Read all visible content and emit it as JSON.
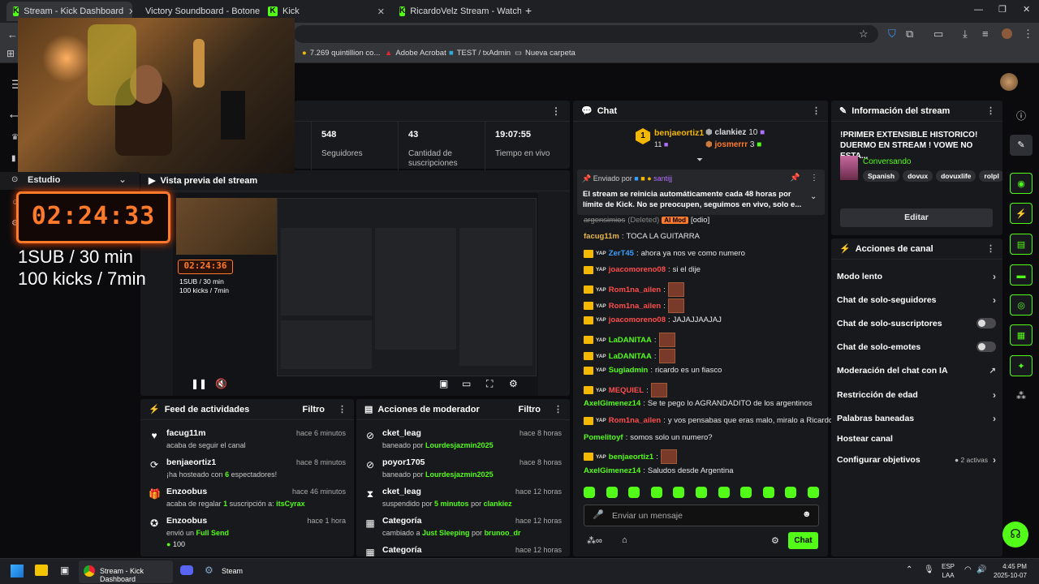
{
  "browser": {
    "tabs": [
      {
        "title": "Stream - Kick Dashboard",
        "icon": "kick"
      },
      {
        "title": "Victory Soundboard - Botones",
        "icon": "victory"
      },
      {
        "title": "Kick",
        "icon": "kick"
      },
      {
        "title": "RicardoVelz Stream - Watch",
        "icon": "kick"
      }
    ],
    "bookmarks": [
      "7.269 quintillion co...",
      "Adobe Acrobat",
      "TEST / txAdmin",
      "Nueva carpeta"
    ]
  },
  "stats": [
    {
      "value": "548",
      "label": "Seguidores"
    },
    {
      "value": "43",
      "label": "Cantidad de suscripciones"
    },
    {
      "value": "19:07:55",
      "label": "Tiempo en vivo"
    }
  ],
  "overlay": {
    "scene": "Estudio",
    "timer": "02:24:33",
    "line1": "1SUB / 30 min",
    "line2": "100 kicks / 7min"
  },
  "preview": {
    "title": "Vista previa del stream",
    "mini_timer": "02:24:36",
    "mini_line1": "1SUB / 30 min",
    "mini_line2": "100 kicks / 7min"
  },
  "feed": {
    "title": "Feed de actividades",
    "filter": "Filtro",
    "items": [
      {
        "name": "facug11m",
        "desc": "acaba de seguir el canal",
        "time": "hace 6 minutos",
        "icon": "heart-icon"
      },
      {
        "name": "benjaeortiz1",
        "desc_pre": "¡ha hosteado con ",
        "desc_hl": "6",
        "desc_post": " espectadores!",
        "time": "hace 8 minutos",
        "icon": "host-icon"
      },
      {
        "name": "Enzoobus",
        "desc_pre": "acaba de regalar ",
        "desc_hl": "1",
        "desc_post": " suscripción a: ",
        "desc_hl2": "itsCyrax",
        "time": "hace 46 minutos",
        "icon": "gift-icon"
      },
      {
        "name": "Enzoobus",
        "desc_pre": "envió un ",
        "desc_hl": "Full Send",
        "kicks": "100",
        "time": "hace 1 hora",
        "icon": "kicks-icon"
      }
    ]
  },
  "mod": {
    "title": "Acciones de moderador",
    "filter": "Filtro",
    "items": [
      {
        "name": "cket_leag",
        "desc_pre": "baneado por ",
        "desc_hl": "Lourdesjazmin2025",
        "time": "hace 8 horas",
        "icon": "ban-icon"
      },
      {
        "name": "poyor1705",
        "desc_pre": "baneado por ",
        "desc_hl": "Lourdesjazmin2025",
        "time": "hace 8 horas",
        "icon": "ban-icon"
      },
      {
        "name": "cket_leag",
        "desc_pre": "suspendido por ",
        "desc_hl": "5 minutos",
        "desc_post": " por ",
        "desc_hl2": "clankiez",
        "time": "hace 12 horas",
        "icon": "timeout-icon"
      },
      {
        "name": "Categoría",
        "desc_pre": "cambiado a ",
        "desc_hl": "Just Sleeping",
        "desc_post": " por ",
        "desc_hl2": "brunoo_dr",
        "time": "hace 12 horas",
        "icon": "category-icon"
      },
      {
        "name": "Categoría",
        "time": "hace 12 horas",
        "icon": "category-icon"
      }
    ]
  },
  "chat": {
    "title": "Chat",
    "top_gifter": {
      "rank": "1",
      "name": "benjaeortiz1",
      "count": "11"
    },
    "gifters": [
      {
        "name": "clankiez",
        "count": "10"
      },
      {
        "name": "josmerrr",
        "count": "3"
      }
    ],
    "pinned": {
      "by_label": "Enviado por",
      "by_name": "santijj",
      "text": "El stream se reinicia automáticamente cada 48 horas por límite de Kick. No se preocupen, seguimos en vivo, solo e..."
    },
    "deleted": {
      "name": "argensimios",
      "tag": "(Deleted)",
      "badge": "AI Mod",
      "extra": "[odio]"
    },
    "messages": [
      {
        "user": "facug11m",
        "color": "#e8b84a",
        "text": "TOCA LA GUITARRA"
      },
      {
        "user": "ZerT45",
        "color": "#3aa0ff",
        "text": "ahora ya nos ve como numero"
      },
      {
        "user": "joacomoreno08",
        "color": "#ff4d4d",
        "text": "si el dije"
      },
      {
        "user": "Rom1na_ailen",
        "color": "#ff4d4d",
        "text": ""
      },
      {
        "user": "Rom1na_ailen",
        "color": "#ff4d4d",
        "text": ""
      },
      {
        "user": "joacomoreno08",
        "color": "#ff4d4d",
        "text": "JAJAJJAAJAJ"
      },
      {
        "user": "LaDANITAA",
        "color": "#53fc18",
        "text": ""
      },
      {
        "user": "LaDANITAA",
        "color": "#53fc18",
        "text": ""
      },
      {
        "user": "Sugiadmin",
        "color": "#53fc18",
        "text": "ricardo es un fiasco"
      },
      {
        "user": "MEQUIEL",
        "color": "#ff4d4d",
        "text": ""
      },
      {
        "user": "AxelGimenez14",
        "color": "#53fc18",
        "text": "Se te pego lo AGRANDADITO de los argentinos"
      },
      {
        "user": "Rom1na_ailen",
        "color": "#ff4d4d",
        "text": "y vos pensabas que eras malo, miralo a Ricardo"
      },
      {
        "user": "Pomelitoyf",
        "color": "#53fc18",
        "text": "somos solo un numero?"
      },
      {
        "user": "benjaeortiz1",
        "color": "#53fc18",
        "text": ""
      },
      {
        "user": "AxelGimenez14",
        "color": "#53fc18",
        "text": "Saludos desde Argentina"
      }
    ],
    "input_placeholder": "Enviar un mensaje",
    "send_label": "Chat"
  },
  "info": {
    "title": "Información del stream",
    "stream_title": "!PRIMER EXTENSIBLE HISTORICO! DUERMO EN STREAM ! VOWE NO ESTA...",
    "category": "Conversando",
    "tags": [
      "Spanish",
      "dovux",
      "dovuxlife",
      "rolpl"
    ],
    "edit_label": "Editar"
  },
  "actions": {
    "title": "Acciones de canal",
    "items": [
      {
        "label": "Modo lento",
        "ctl": "chevron"
      },
      {
        "label": "Chat de solo-seguidores",
        "ctl": "chevron"
      },
      {
        "label": "Chat de solo-suscriptores",
        "ctl": "toggle"
      },
      {
        "label": "Chat de solo-emotes",
        "ctl": "toggle"
      },
      {
        "label": "Moderación del chat con IA",
        "ctl": "ext"
      },
      {
        "label": "Restricción de edad",
        "ctl": "chevron"
      },
      {
        "label": "Palabras baneadas",
        "ctl": "chevron"
      },
      {
        "label": "Hostear canal",
        "ctl": "none"
      },
      {
        "label": "Configurar objetivos",
        "ctl": "chevron",
        "extra": "2 activas"
      }
    ]
  },
  "taskbar": {
    "app": "Stream - Kick Dashboard",
    "steam": "Steam",
    "lang1": "ESP",
    "lang2": "LAA",
    "time": "4:45 PM",
    "date": "2025-10-07"
  }
}
